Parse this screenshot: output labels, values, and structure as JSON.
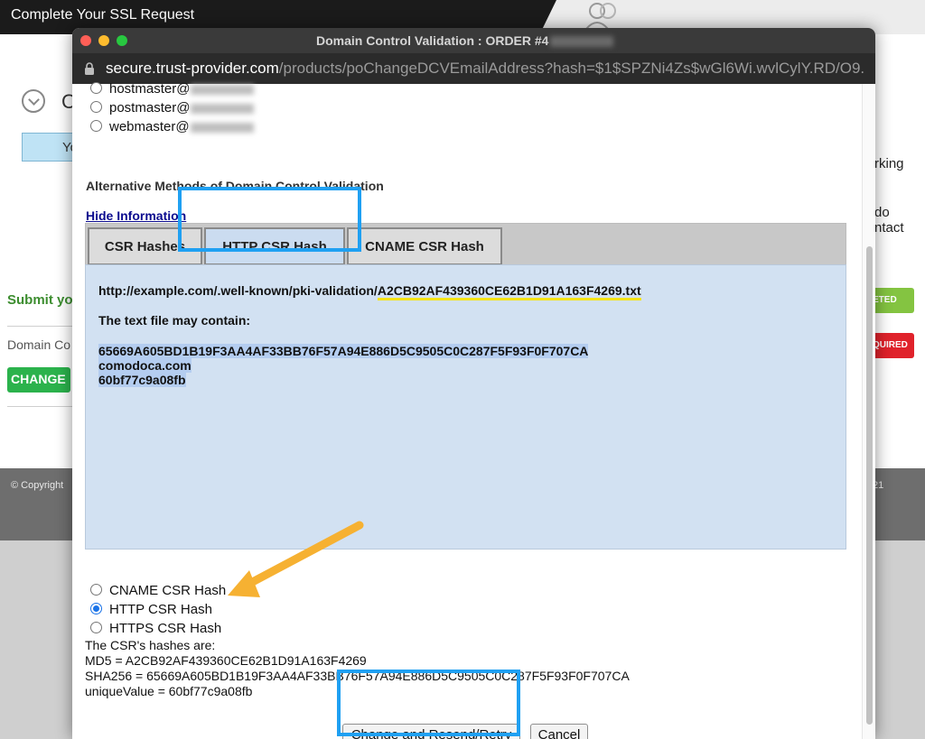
{
  "background": {
    "title": "Complete Your SSL Request",
    "c_letter": "C",
    "yo_text": "Yo",
    "submit_text": "Submit you",
    "domain_text": "Domain Co",
    "change_label": "CHANGE",
    "copyright": "© Copyright",
    "year_fragment": "21",
    "right_texts": [
      "rking",
      "do",
      "ntact"
    ],
    "badge_green": "ETED",
    "badge_red": "QUIRED"
  },
  "window": {
    "title": "Domain Control Validation : ORDER #4",
    "url_domain": "secure.trust-provider.com",
    "url_path": "/products/poChangeDCVEmailAddress?hash=$1$SPZNi4Zs$wGl6Wi.wvlCylY.RD/O9..."
  },
  "emails": [
    {
      "label": "hostmaster@"
    },
    {
      "label": "postmaster@"
    },
    {
      "label": "webmaster@"
    }
  ],
  "alt_heading": "Alternative Methods of Domain Control Validation",
  "hide_link": "Hide Information",
  "tabs": [
    {
      "label": "CSR Hashes",
      "active": false
    },
    {
      "label": "HTTP CSR Hash",
      "active": true
    },
    {
      "label": "CNAME CSR Hash",
      "active": false
    }
  ],
  "panel": {
    "url_prefix": "http://example.com/.well-known/pki-validation/",
    "url_file": "A2CB92AF439360CE62B1D91A163F4269.txt",
    "may_contain": "The text file may contain:",
    "lines": [
      "65669A605BD1B19F3AA4AF33BB76F57A94E886D5C9505C0C287F5F93F0F707CA",
      "comodoca.com",
      "60bf77c9a08fb"
    ]
  },
  "methods": [
    {
      "label": "CNAME CSR Hash",
      "checked": false
    },
    {
      "label": "HTTP CSR Hash",
      "checked": true
    },
    {
      "label": "HTTPS CSR Hash",
      "checked": false
    }
  ],
  "hashes": {
    "intro": "The CSR's hashes are:",
    "md5": "MD5 = A2CB92AF439360CE62B1D91A163F4269",
    "sha256": "SHA256 = 65669A605BD1B19F3AA4AF33BB76F57A94E886D5C9505C0C287F5F93F0F707CA",
    "unique": "uniqueValue = 60bf77c9a08fb"
  },
  "buttons": {
    "change_resend": "Change and Resend/Retry",
    "cancel": "Cancel"
  },
  "colors": {
    "callout_blue": "#1fa0f2",
    "arrow_orange": "#f6b132",
    "highlight_yellow": "#f5e417"
  }
}
